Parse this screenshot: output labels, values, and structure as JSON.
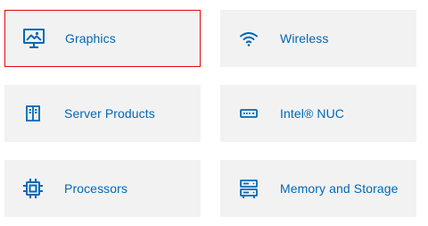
{
  "accent_color": "#0068b5",
  "selected_border_color": "#e30613",
  "tile_background": "#f2f2f2",
  "categories": [
    {
      "label": "Graphics",
      "icon": "monitor-icon",
      "selected": true
    },
    {
      "label": "Wireless",
      "icon": "wifi-icon",
      "selected": false
    },
    {
      "label": "Server Products",
      "icon": "server-icon",
      "selected": false
    },
    {
      "label": "Intel® NUC",
      "icon": "mini-pc-icon",
      "selected": false
    },
    {
      "label": "Processors",
      "icon": "processor-chip-icon",
      "selected": false
    },
    {
      "label": "Memory and Storage",
      "icon": "storage-drive-icon",
      "selected": false
    }
  ]
}
